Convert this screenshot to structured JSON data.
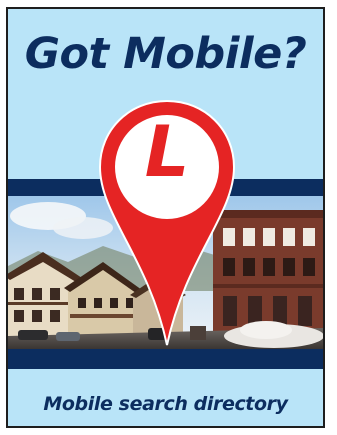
{
  "ad": {
    "headline": "Got Mobile?",
    "tagline": "Mobile search directory"
  },
  "pin": {
    "letter": "L",
    "icon": "map-pin-icon"
  },
  "photo": {
    "icon": "street-scene-photo"
  },
  "colors": {
    "background": "#b9e4f8",
    "navy": "#0c2d5f",
    "pin_red": "#e52424",
    "white": "#ffffff"
  }
}
